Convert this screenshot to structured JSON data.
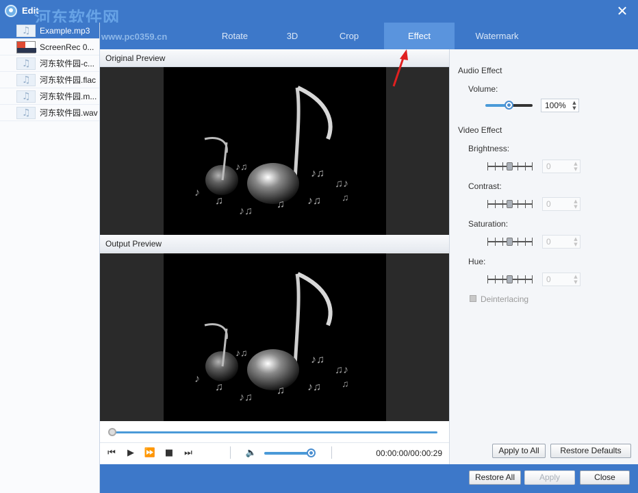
{
  "window": {
    "title": "Edit",
    "watermark": "河东软件网",
    "watermark_url": "www.pc0359.cn"
  },
  "files": [
    {
      "name": "Example.mp3",
      "thumb": "music",
      "selected": true
    },
    {
      "name": "ScreenRec 0...",
      "thumb": "screen",
      "selected": false
    },
    {
      "name": "河东软件园-c...",
      "thumb": "music",
      "selected": false
    },
    {
      "name": "河东软件园.flac",
      "thumb": "music",
      "selected": false
    },
    {
      "name": "河东软件园.m...",
      "thumb": "music",
      "selected": false
    },
    {
      "name": "河东软件园.wav",
      "thumb": "music",
      "selected": false
    }
  ],
  "tabs": [
    {
      "label": "Rotate",
      "active": false
    },
    {
      "label": "3D",
      "active": false
    },
    {
      "label": "Crop",
      "active": false
    },
    {
      "label": "Effect",
      "active": true
    },
    {
      "label": "Watermark",
      "active": false
    }
  ],
  "preview": {
    "original_label": "Original Preview",
    "output_label": "Output Preview"
  },
  "playback": {
    "time": "00:00:00/00:00:29",
    "volume_level": 0.9,
    "progress": 0.0
  },
  "effect": {
    "audio_label": "Audio Effect",
    "volume_label": "Volume:",
    "volume_value": "100%",
    "video_label": "Video Effect",
    "brightness_label": "Brightness:",
    "brightness_value": "0",
    "contrast_label": "Contrast:",
    "contrast_value": "0",
    "saturation_label": "Saturation:",
    "saturation_value": "0",
    "hue_label": "Hue:",
    "hue_value": "0",
    "deinterlacing_label": "Deinterlacing",
    "apply_all_label": "Apply to All",
    "restore_defaults_label": "Restore Defaults"
  },
  "footer": {
    "restore_all_label": "Restore All",
    "apply_label": "Apply",
    "close_label": "Close"
  },
  "colors": {
    "accent": "#3d78c9",
    "tab_active": "#5a94dd",
    "slider": "#4a9ad8",
    "annotation_arrow": "#e02020"
  }
}
